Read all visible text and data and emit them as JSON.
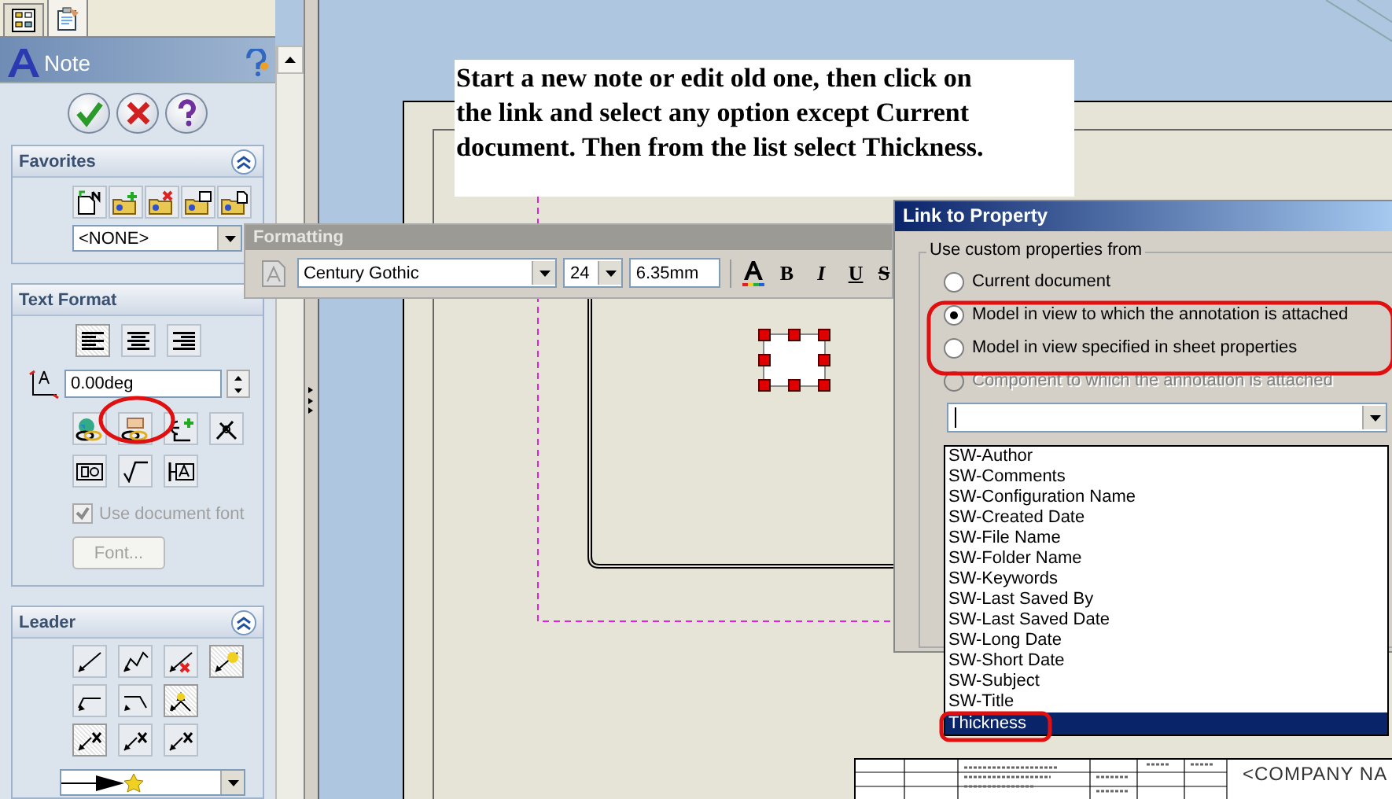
{
  "panel_tabs": [
    {
      "selected": false
    },
    {
      "selected": true
    }
  ],
  "property_manager": {
    "title": "Note"
  },
  "favorites": {
    "title": "Favorites",
    "style_value": "<NONE>"
  },
  "text_format": {
    "title": "Text Format",
    "align_buttons": [
      {
        "selected": true
      },
      {
        "selected": false
      },
      {
        "selected": false
      }
    ],
    "angle": "0.00deg",
    "use_document_font": {
      "label": "Use document font",
      "checked": true,
      "disabled": true
    },
    "font_button": {
      "label": "Font...",
      "disabled": true
    }
  },
  "leader": {
    "title": "Leader",
    "buttons": [
      {
        "selected": false
      },
      {
        "selected": false
      },
      {
        "selected": false
      },
      {
        "selected": true
      },
      {
        "selected": false
      },
      {
        "selected": false
      },
      {
        "selected": true
      },
      {
        "selected": true
      },
      {
        "selected": false
      },
      {
        "selected": false
      }
    ]
  },
  "note_callout": "Start a new note or edit old one, then click on the link and select any option except Current document. Then from the list select Thickness.",
  "formatting_toolbar": {
    "title": "Formatting",
    "font": "Century Gothic",
    "size": "24",
    "height": "6.35mm",
    "style_buttons": [
      "B",
      "I",
      "U",
      "S"
    ]
  },
  "link_dialog": {
    "title": "Link to Property",
    "group_label": "Use custom properties from",
    "options": [
      {
        "label": "Current document",
        "selected": false,
        "disabled": false
      },
      {
        "label": "Model in view to which the annotation is attached",
        "selected": true,
        "disabled": false
      },
      {
        "label": "Model in view specified in sheet properties",
        "selected": false,
        "disabled": false
      },
      {
        "label": "Component to which the annotation is attached",
        "selected": false,
        "disabled": true
      }
    ],
    "properties": [
      {
        "label": "SW-Author",
        "selected": false
      },
      {
        "label": "SW-Comments",
        "selected": false
      },
      {
        "label": "SW-Configuration Name",
        "selected": false
      },
      {
        "label": "SW-Created Date",
        "selected": false
      },
      {
        "label": "SW-File Name",
        "selected": false
      },
      {
        "label": "SW-Folder Name",
        "selected": false
      },
      {
        "label": "SW-Keywords",
        "selected": false
      },
      {
        "label": "SW-Last Saved By",
        "selected": false
      },
      {
        "label": "SW-Last Saved Date",
        "selected": false
      },
      {
        "label": "SW-Long Date",
        "selected": false
      },
      {
        "label": "SW-Short Date",
        "selected": false
      },
      {
        "label": "SW-Subject",
        "selected": false
      },
      {
        "label": "SW-Title",
        "selected": false
      },
      {
        "label": "Thickness",
        "selected": true
      }
    ]
  },
  "title_block": {
    "company": "<COMPANY NA"
  }
}
